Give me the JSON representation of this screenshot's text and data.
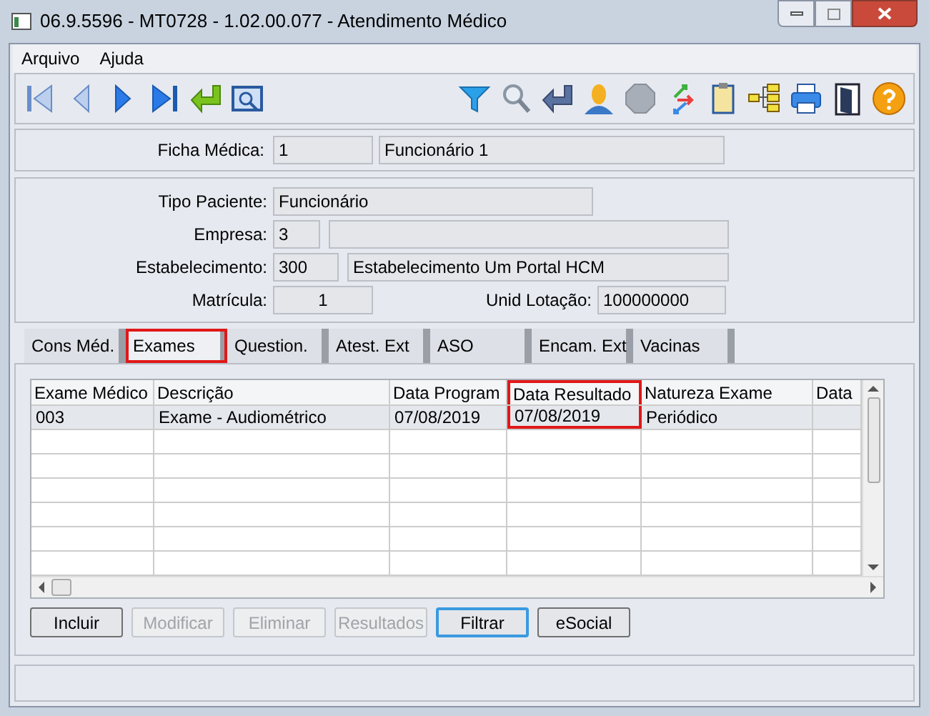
{
  "window": {
    "title": "06.9.5596 - MT0728 - 1.02.00.077 - Atendimento Médico"
  },
  "menu": [
    {
      "label": "Arquivo"
    },
    {
      "label": "Ajuda"
    }
  ],
  "ficha": {
    "label": "Ficha Médica:",
    "code": "1",
    "name": "Funcionário 1"
  },
  "patient": {
    "tipo_label": "Tipo Paciente:",
    "tipo": "Funcionário",
    "empresa_label": "Empresa:",
    "empresa": "3",
    "estab_label": "Estabelecimento:",
    "estab_code": "300",
    "estab_name": "Estabelecimento Um Portal HCM",
    "matricula_label": "Matrícula:",
    "matricula": "1",
    "lotacao_label": "Unid Lotação:",
    "lotacao": "100000000"
  },
  "tabs": [
    {
      "label": "Cons Méd.",
      "selected": false,
      "highlighted": false
    },
    {
      "label": "Exames",
      "selected": true,
      "highlighted": true
    },
    {
      "label": "Question.",
      "selected": false,
      "highlighted": false
    },
    {
      "label": "Atest. Ext",
      "selected": false,
      "highlighted": false
    },
    {
      "label": "ASO",
      "selected": false,
      "highlighted": false
    },
    {
      "label": "Encam. Ext",
      "selected": false,
      "highlighted": false
    },
    {
      "label": "Vacinas",
      "selected": false,
      "highlighted": false
    }
  ],
  "table": {
    "columns": [
      {
        "label": "Exame Médico",
        "highlighted": false
      },
      {
        "label": "Descrição",
        "highlighted": false
      },
      {
        "label": "Data Program",
        "highlighted": false
      },
      {
        "label": "Data Resultado",
        "highlighted": true
      },
      {
        "label": "Natureza Exame",
        "highlighted": false
      },
      {
        "label": "Data",
        "highlighted": false
      }
    ],
    "rows": [
      [
        "003",
        "Exame - Audiométrico",
        "07/08/2019",
        "07/08/2019",
        "Periódico"
      ]
    ]
  },
  "buttons": [
    {
      "label": "Incluir",
      "disabled": false,
      "focused": false
    },
    {
      "label": "Modificar",
      "disabled": true,
      "focused": false
    },
    {
      "label": "Eliminar",
      "disabled": true,
      "focused": false
    },
    {
      "label": "Resultados",
      "disabled": true,
      "focused": false
    },
    {
      "label": "Filtrar",
      "disabled": false,
      "focused": true
    },
    {
      "label": "eSocial",
      "disabled": false,
      "focused": false
    }
  ]
}
